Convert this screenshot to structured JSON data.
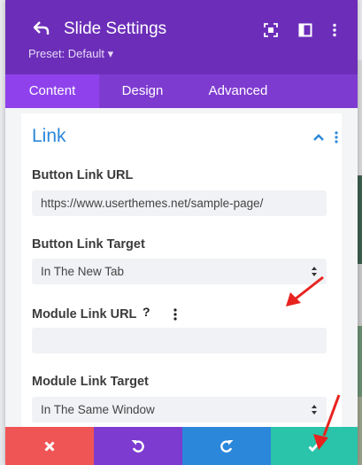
{
  "header": {
    "title": "Slide Settings",
    "preset": "Preset: Default ▾",
    "bg_color": "#6c2eb9"
  },
  "tabs": [
    {
      "label": "Content",
      "active": true
    },
    {
      "label": "Design",
      "active": false
    },
    {
      "label": "Advanced",
      "active": false
    }
  ],
  "section": {
    "title": "Link",
    "fields": {
      "button_link_url": {
        "label": "Button Link URL",
        "value": "https://www.userthemes.net/sample-page/"
      },
      "button_link_target": {
        "label": "Button Link Target",
        "value": "In The New Tab"
      },
      "module_link_url": {
        "label": "Module Link URL",
        "value": "",
        "help_icon": "?"
      },
      "module_link_target": {
        "label": "Module Link Target",
        "value": "In The Same Window"
      }
    }
  },
  "footer": {
    "cancel": {
      "icon": "close-icon",
      "color": "#ef5555"
    },
    "undo": {
      "icon": "undo-icon",
      "color": "#7e3bd0"
    },
    "redo": {
      "icon": "redo-icon",
      "color": "#2b87da"
    },
    "save": {
      "icon": "check-icon",
      "color": "#29c4a9"
    }
  },
  "annotation_color": "#e8231f"
}
